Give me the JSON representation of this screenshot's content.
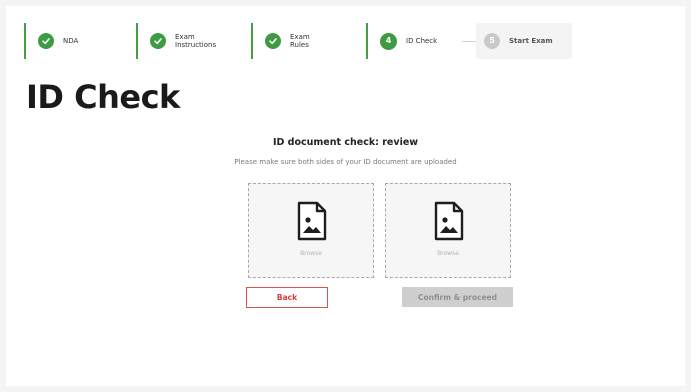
{
  "stepper": {
    "steps": [
      {
        "label": "NDA",
        "state": "done"
      },
      {
        "label": "Exam\nInstructions",
        "state": "done"
      },
      {
        "label": "Exam\nRules",
        "state": "done"
      },
      {
        "label": "ID Check",
        "state": "current",
        "number": "4"
      },
      {
        "label": "Start Exam",
        "state": "pending",
        "number": "5"
      }
    ]
  },
  "page": {
    "title": "ID Check"
  },
  "review": {
    "heading": "ID document check: review",
    "instructions": "Please make sure both sides of your ID document are uploaded",
    "front": {
      "browse_label": "Browse"
    },
    "back": {
      "browse_label": "Browse"
    }
  },
  "actions": {
    "back_label": "Back",
    "confirm_label": "Confirm & proceed"
  },
  "colors": {
    "accent_green": "#3f9b43",
    "back_red": "#d33b35",
    "disabled_gray": "#cfcfcf"
  }
}
